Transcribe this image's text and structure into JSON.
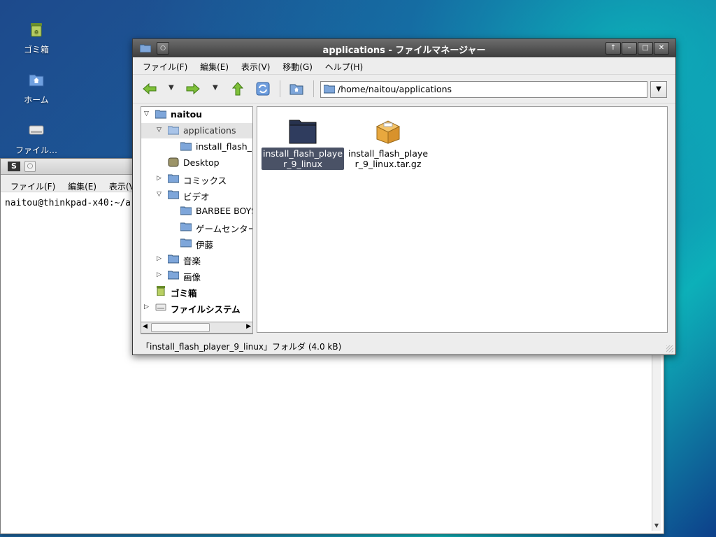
{
  "desktop": {
    "icons": [
      {
        "label": "ゴミ箱",
        "icon": "trash-icon"
      },
      {
        "label": "ホーム",
        "icon": "home-icon"
      },
      {
        "label": "ファイル…",
        "icon": "filesystem-icon"
      }
    ]
  },
  "terminal": {
    "menu": [
      "ファイル(F)",
      "編集(E)",
      "表示(V"
    ],
    "prompt": "naitou@thinkpad-x40:~/a"
  },
  "file_manager": {
    "title": "applications - ファイルマネージャー",
    "menu": [
      "ファイル(F)",
      "編集(E)",
      "表示(V)",
      "移動(G)",
      "ヘルプ(H)"
    ],
    "address": "/home/naitou/applications",
    "tree": [
      {
        "label": "naitou",
        "bold": true,
        "expanded": true
      },
      {
        "label": "applications",
        "expanded": true,
        "selected": true
      },
      {
        "label": "install_flash_"
      },
      {
        "label": "Desktop"
      },
      {
        "label": "コミックス"
      },
      {
        "label": "ビデオ",
        "expanded": true
      },
      {
        "label": "BARBEE BOYS"
      },
      {
        "label": "ゲームセンター"
      },
      {
        "label": "伊藤"
      },
      {
        "label": "音楽"
      },
      {
        "label": "画像"
      },
      {
        "label": "ゴミ箱",
        "bold": true
      },
      {
        "label": "ファイルシステム",
        "bold": true
      }
    ],
    "files": [
      {
        "line1": "install_flash_playe",
        "line2": "r_9_linux",
        "icon": "folder-icon",
        "selected": true
      },
      {
        "line1": "install_flash_playe",
        "line2": "r_9_linux.tar.gz",
        "icon": "package-icon",
        "selected": false
      }
    ],
    "status": "「install_flash_player_9_linux」フォルダ (4.0 kB)"
  },
  "colors": {
    "selection": "#4a5266",
    "folder_blue": "#5b8fd6",
    "titlebar": "#4a4a4a"
  }
}
